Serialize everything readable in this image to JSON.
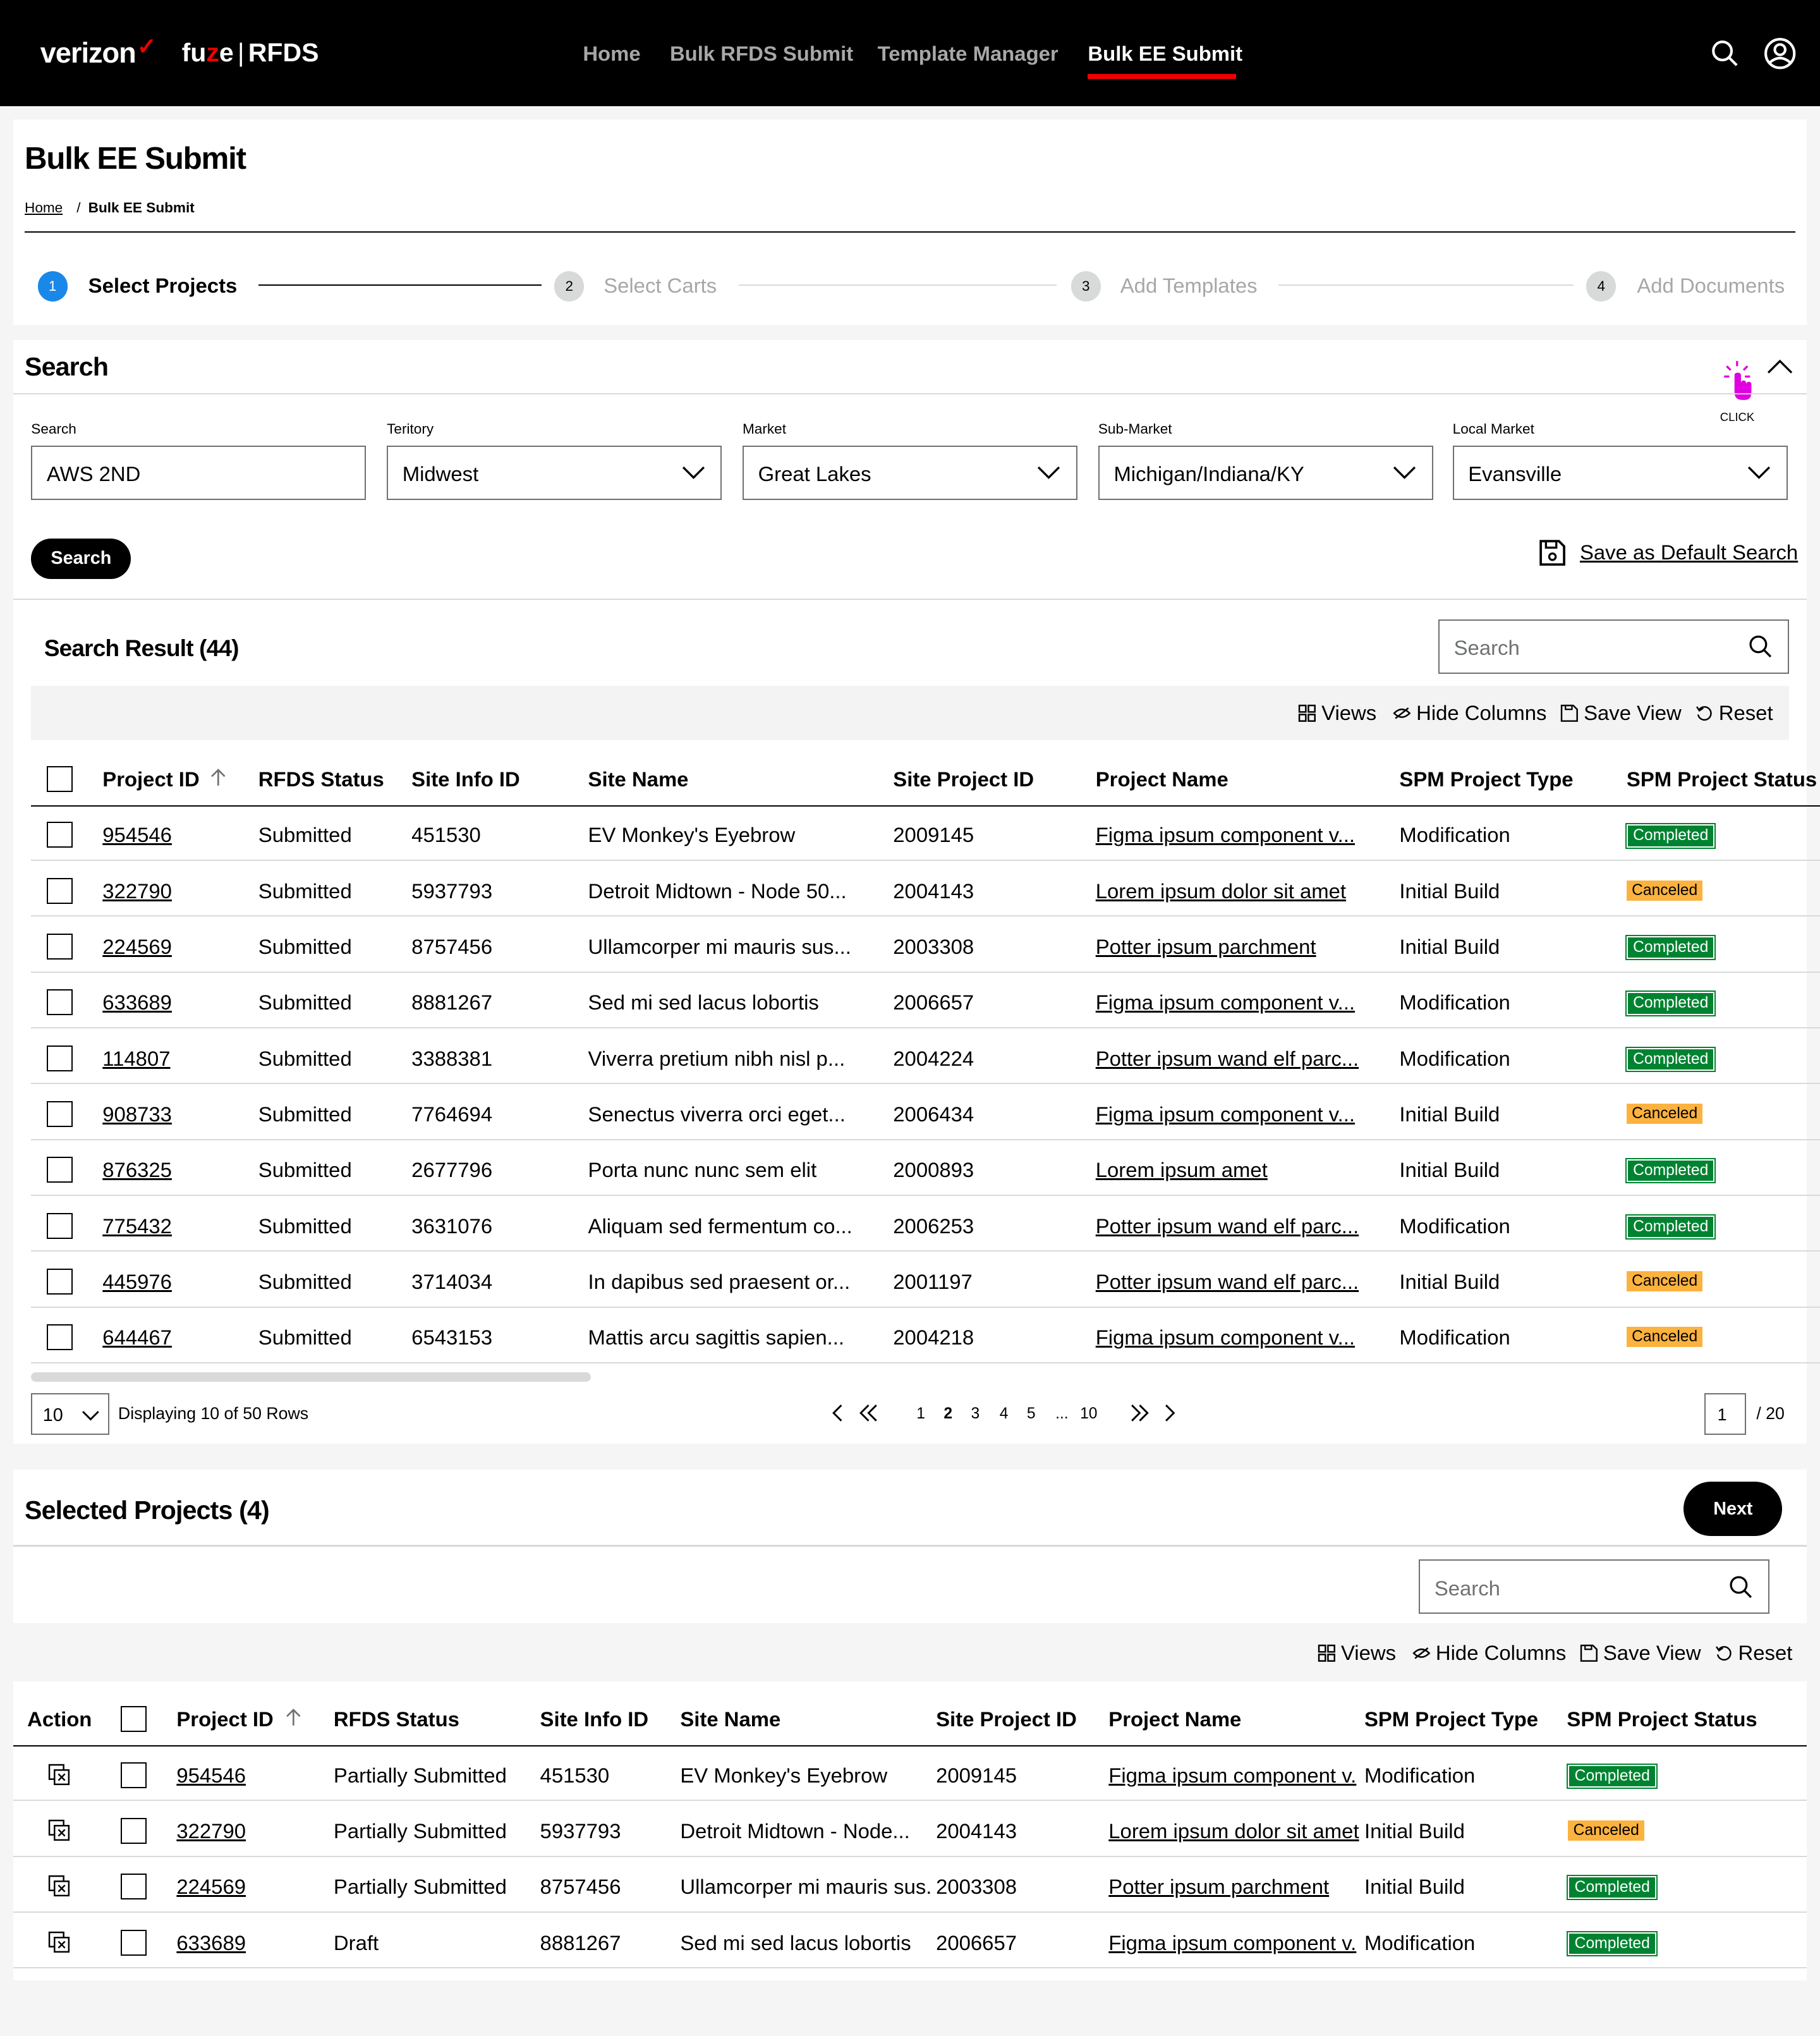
{
  "nav": {
    "brand": "verizon",
    "brand_check": "✓",
    "app_fu": "fu",
    "app_z": "z",
    "app_e": "e",
    "app_sep": "|",
    "app_name": "RFDS",
    "links": [
      "Home",
      "Bulk RFDS Submit",
      "Template Manager",
      "Bulk EE Submit"
    ],
    "active": "Bulk EE Submit",
    "icons": [
      "search-icon",
      "user-icon"
    ]
  },
  "page": {
    "title": "Bulk EE Submit",
    "breadcrumb_home": "Home",
    "breadcrumb_sep": "/",
    "breadcrumb_current": "Bulk EE Submit"
  },
  "stepper": [
    {
      "num": "1",
      "label": "Select Projects"
    },
    {
      "num": "2",
      "label": "Select Carts"
    },
    {
      "num": "3",
      "label": "Add Templates"
    },
    {
      "num": "4",
      "label": "Add Documents"
    }
  ],
  "search": {
    "title": "Search",
    "click_hint": "CLICK",
    "fields": [
      {
        "label": "Search",
        "value": "AWS 2ND"
      },
      {
        "label": "Teritory",
        "value": "Midwest"
      },
      {
        "label": "Market",
        "value": "Great Lakes"
      },
      {
        "label": "Sub-Market",
        "value": "Michigan/Indiana/KY"
      },
      {
        "label": "Local Market",
        "value": "Evansville"
      }
    ],
    "button": "Search",
    "save_default": "Save as Default Search"
  },
  "results": {
    "title": "Search Result (44)",
    "search_placeholder": "Search",
    "toolbar": [
      "Views",
      "Hide Columns",
      "Save View",
      "Reset"
    ],
    "columns": [
      "Project ID",
      "RFDS Status",
      "Site Info ID",
      "Site Name",
      "Site Project ID",
      "Project Name",
      "SPM Project Type",
      "SPM Project Status"
    ],
    "rows": [
      [
        "954546",
        "Submitted",
        "451530",
        "EV Monkey's Eyebrow",
        "2009145",
        "Figma ipsum component v...",
        "Modification",
        "Completed"
      ],
      [
        "322790",
        "Submitted",
        "5937793",
        "Detroit Midtown - Node 50...",
        "2004143",
        "Lorem ipsum dolor sit amet",
        "Initial Build",
        "Canceled"
      ],
      [
        "224569",
        "Submitted",
        "8757456",
        "Ullamcorper mi mauris sus...",
        "2003308",
        "Potter ipsum parchment",
        "Initial Build",
        "Completed"
      ],
      [
        "633689",
        "Submitted",
        "8881267",
        "Sed mi sed lacus lobortis",
        "2006657",
        "Figma ipsum component v...",
        "Modification",
        "Completed"
      ],
      [
        "114807",
        "Submitted",
        "3388381",
        "Viverra pretium nibh nisl p...",
        "2004224",
        "Potter ipsum wand elf parc...",
        "Modification",
        "Completed"
      ],
      [
        "908733",
        "Submitted",
        "7764694",
        "Senectus viverra orci eget...",
        "2006434",
        "Figma ipsum component v...",
        "Initial Build",
        "Canceled"
      ],
      [
        "876325",
        "Submitted",
        "2677796",
        "Porta nunc nunc sem elit",
        "2000893",
        "Lorem ipsum amet",
        "Initial Build",
        "Completed"
      ],
      [
        "775432",
        "Submitted",
        "3631076",
        "Aliquam sed fermentum co...",
        "2006253",
        "Potter ipsum wand elf parc...",
        "Modification",
        "Completed"
      ],
      [
        "445976",
        "Submitted",
        "3714034",
        "In dapibus sed praesent or...",
        "2001197",
        "Potter ipsum wand elf parc...",
        "Initial Build",
        "Canceled"
      ],
      [
        "644467",
        "Submitted",
        "6543153",
        "Mattis arcu sagittis sapien...",
        "2004218",
        "Figma ipsum component v...",
        "Modification",
        "Canceled"
      ]
    ],
    "pagination": {
      "page_size": "10",
      "display": "Displaying 10 of 50 Rows",
      "pages": [
        "1",
        "2",
        "3",
        "4",
        "5",
        "...",
        "10"
      ],
      "current": "2",
      "page_input": "1",
      "total": "/ 20"
    }
  },
  "selected": {
    "title": "Selected Projects (4)",
    "next": "Next",
    "search_placeholder": "Search",
    "toolbar": [
      "Views",
      "Hide Columns",
      "Save View",
      "Reset"
    ],
    "columns": [
      "Action",
      "Project ID",
      "RFDS Status",
      "Site Info ID",
      "Site Name",
      "Site Project ID",
      "Project Name",
      "SPM Project Type",
      "SPM Project Status"
    ],
    "rows": [
      [
        "954546",
        "Partially Submitted",
        "451530",
        "EV Monkey's Eyebrow",
        "2009145",
        "Figma ipsum component v.",
        "Modification",
        "Completed"
      ],
      [
        "322790",
        "Partially Submitted",
        "5937793",
        "Detroit Midtown - Node...",
        "2004143",
        "Lorem ipsum dolor sit amet",
        "Initial Build",
        "Canceled"
      ],
      [
        "224569",
        "Partially Submitted",
        "8757456",
        "Ullamcorper mi mauris sus.",
        "2003308",
        "Potter ipsum parchment",
        "Initial Build",
        "Completed"
      ],
      [
        "633689",
        "Draft",
        "8881267",
        "Sed mi sed lacus lobortis",
        "2006657",
        "Figma ipsum component v.",
        "Modification",
        "Completed"
      ]
    ]
  },
  "colors": {
    "brand_red": "#ee0000",
    "completed": "#008331",
    "canceled": "#fcb23f",
    "step_active": "#1a88e8"
  }
}
